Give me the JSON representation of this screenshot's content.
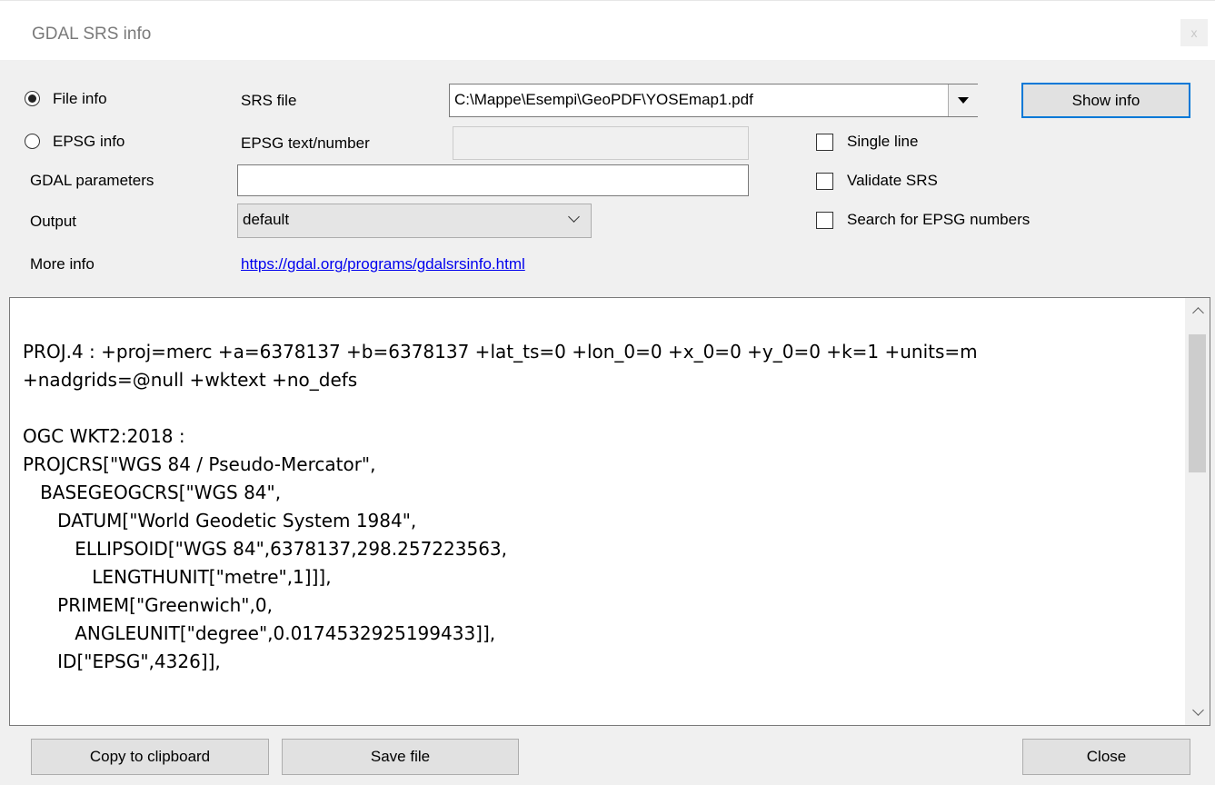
{
  "window": {
    "title": "GDAL SRS info",
    "close_glyph": "x"
  },
  "mode": {
    "file_info_label": "File info",
    "epsg_info_label": "EPSG info",
    "selected": "file_info"
  },
  "fields": {
    "srs_file_label": "SRS file",
    "srs_file_value": "C:\\Mappe\\Esempi\\GeoPDF\\YOSEmap1.pdf",
    "epsg_label": "EPSG text/number",
    "epsg_value": "",
    "gdal_params_label": "GDAL parameters",
    "gdal_params_value": "",
    "output_label": "Output",
    "output_value": "default",
    "more_info_label": "More info",
    "more_info_link": "https://gdal.org/programs/gdalsrsinfo.html"
  },
  "options": {
    "single_line": {
      "label": "Single line",
      "checked": false
    },
    "validate_srs": {
      "label": "Validate SRS",
      "checked": false
    },
    "search_epsg": {
      "label": "Search for EPSG numbers",
      "checked": false
    }
  },
  "buttons": {
    "show_info": "Show info",
    "copy_clipboard": "Copy to clipboard",
    "save_file": "Save file",
    "close": "Close"
  },
  "output_text": "PROJ.4 : +proj=merc +a=6378137 +b=6378137 +lat_ts=0 +lon_0=0 +x_0=0 +y_0=0 +k=1 +units=m\n+nadgrids=@null +wktext +no_defs\n\nOGC WKT2:2018 :\nPROJCRS[\"WGS 84 / Pseudo-Mercator\",\n   BASEGEOGCRS[\"WGS 84\",\n      DATUM[\"World Geodetic System 1984\",\n         ELLIPSOID[\"WGS 84\",6378137,298.257223563,\n            LENGTHUNIT[\"metre\",1]]],\n      PRIMEM[\"Greenwich\",0,\n         ANGLEUNIT[\"degree\",0.0174532925199433]],\n      ID[\"EPSG\",4326]],",
  "colors": {
    "accent": "#0078d7",
    "link": "#0000ee",
    "window_bg": "#f0f0f0"
  },
  "icons": {
    "dropdown": "triangle-down",
    "select_chevron": "chevron-down",
    "scroll_up": "chevron-up",
    "scroll_down": "chevron-down"
  }
}
